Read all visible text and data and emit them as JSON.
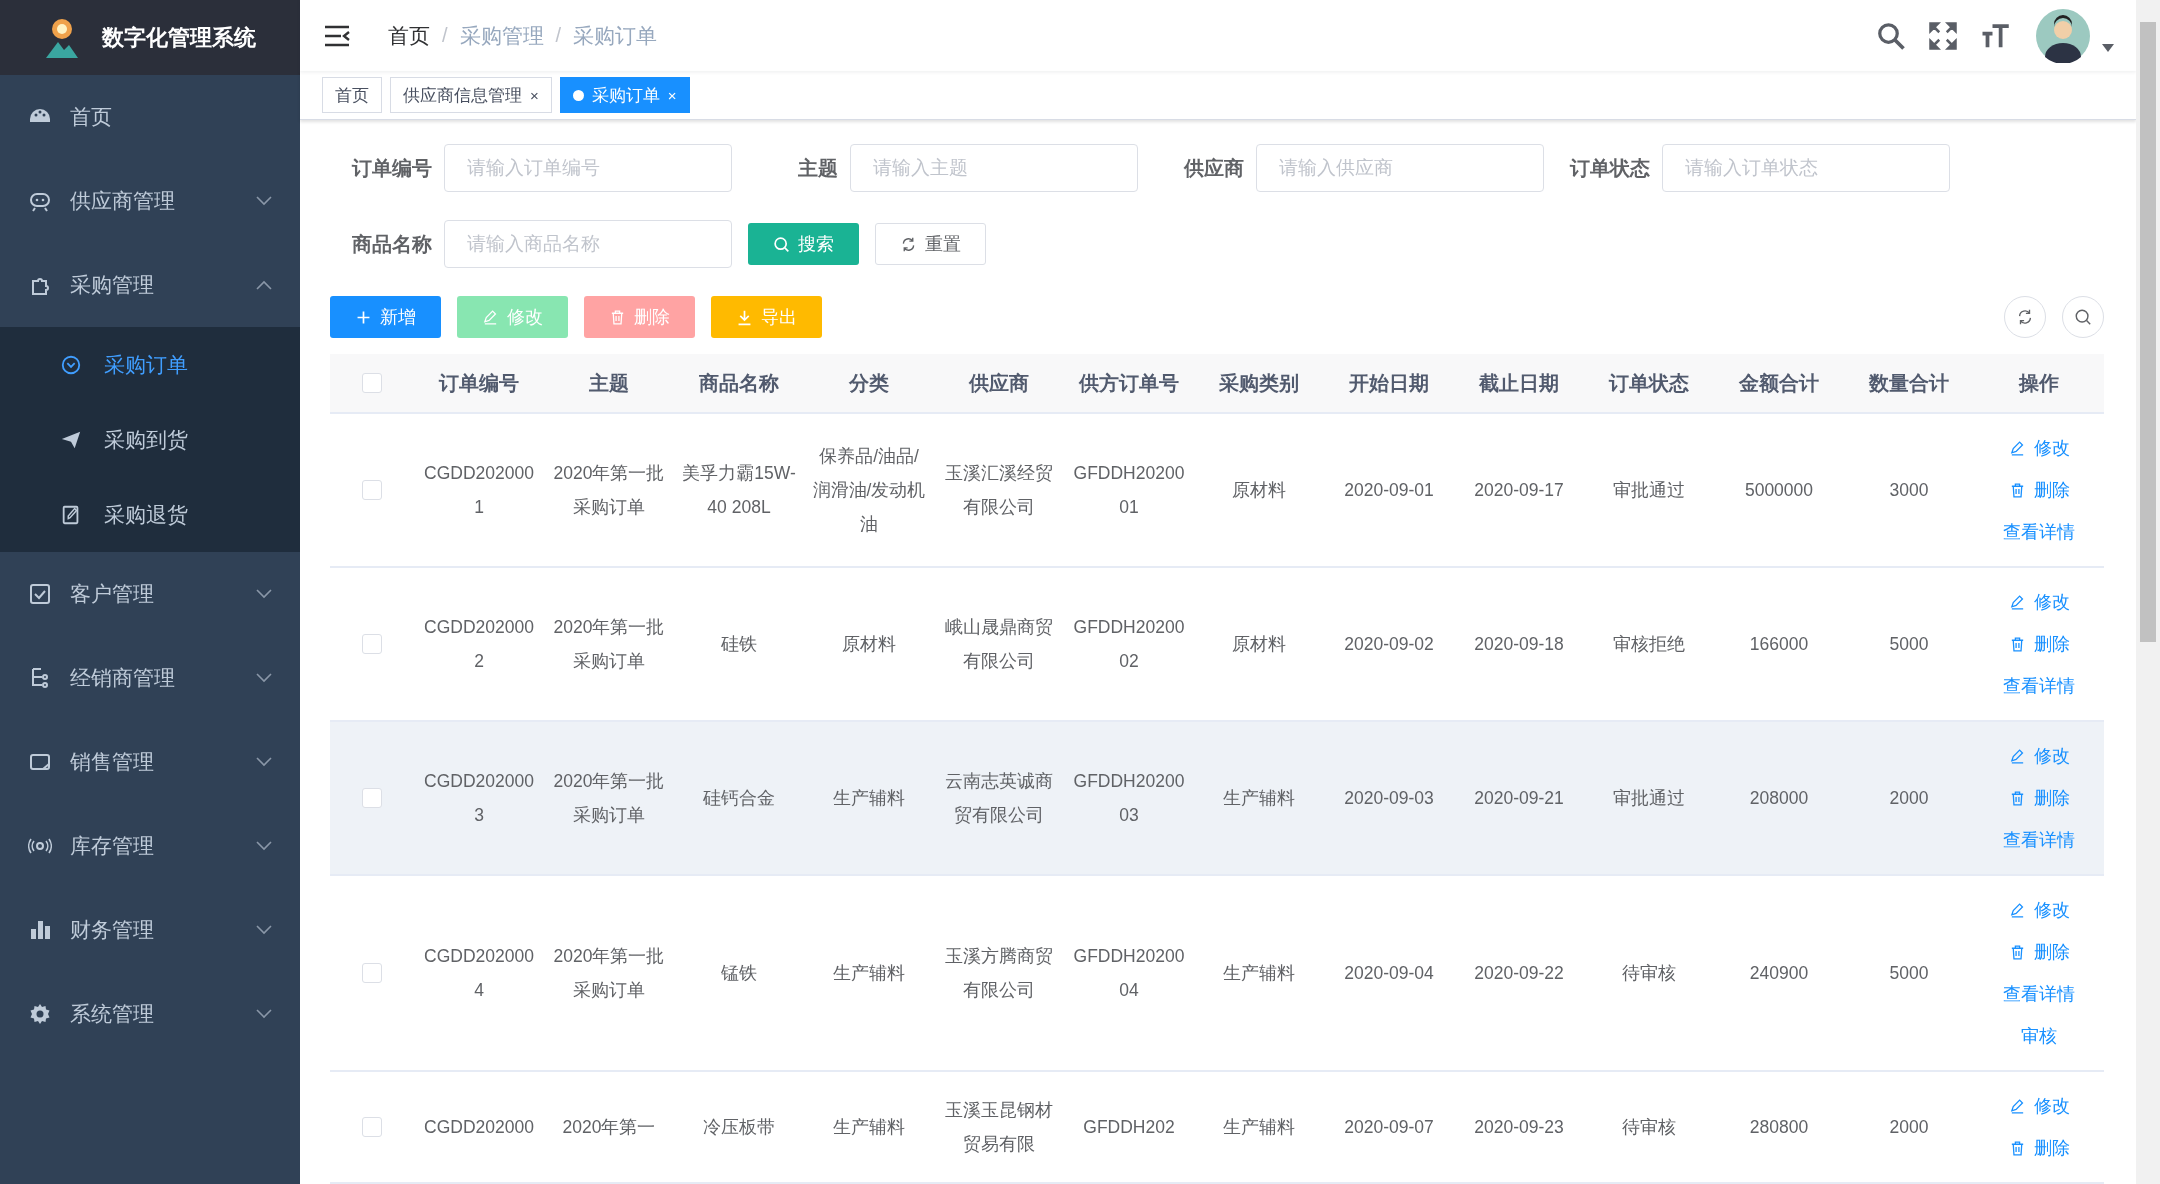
{
  "sidebar": {
    "title": "数字化管理系统",
    "items": [
      {
        "label": "首页",
        "has_children": false
      },
      {
        "label": "供应商管理",
        "expanded": false,
        "has_children": true
      },
      {
        "label": "采购管理",
        "expanded": true,
        "has_children": true,
        "children": [
          {
            "label": "采购订单",
            "selected": true
          },
          {
            "label": "采购到货",
            "selected": false
          },
          {
            "label": "采购退货",
            "selected": false
          }
        ]
      },
      {
        "label": "客户管理",
        "expanded": false,
        "has_children": true
      },
      {
        "label": "经销商管理",
        "expanded": false,
        "has_children": true
      },
      {
        "label": "销售管理",
        "expanded": false,
        "has_children": true
      },
      {
        "label": "库存管理",
        "expanded": false,
        "has_children": true
      },
      {
        "label": "财务管理",
        "expanded": false,
        "has_children": true
      },
      {
        "label": "系统管理",
        "expanded": false,
        "has_children": true
      }
    ]
  },
  "breadcrumb": [
    {
      "label": "首页"
    },
    {
      "separator": "/",
      "label": "采购管理"
    },
    {
      "separator": "/",
      "label": "采购订单"
    }
  ],
  "tabs": [
    {
      "label": "首页",
      "selected": false,
      "closable": false
    },
    {
      "label": "供应商信息管理",
      "selected": false,
      "closable": true,
      "close": "×"
    },
    {
      "label": "采购订单",
      "selected": true,
      "closable": true,
      "close": "×"
    }
  ],
  "filters": [
    {
      "label": "订单编号",
      "placeholder": "请输入订单编号"
    },
    {
      "label": "主题",
      "placeholder": "请输入主题"
    },
    {
      "label": "供应商",
      "placeholder": "请输入供应商"
    },
    {
      "label": "订单状态",
      "placeholder": "请输入订单状态"
    },
    {
      "label": "商品名称",
      "placeholder": "请输入商品名称"
    }
  ],
  "search_button": "搜索",
  "reset_button": "重置",
  "toolbar": [
    {
      "kind": "add",
      "label": "新增",
      "disabled": false
    },
    {
      "kind": "edit",
      "label": "修改",
      "disabled": true
    },
    {
      "kind": "delete",
      "label": "删除",
      "disabled": true
    },
    {
      "kind": "export",
      "label": "导出",
      "disabled": false
    }
  ],
  "table": {
    "all_checked": false,
    "columns": [
      "订单编号",
      "主题",
      "商品名称",
      "分类",
      "供应商",
      "供方订单号",
      "采购类别",
      "开始日期",
      "截止日期",
      "订单状态",
      "金额合计",
      "数量合计",
      "操作"
    ],
    "rows": [
      {
        "checked": false,
        "hovered": false,
        "cells": [
          "CGDD2020001",
          "2020年第一批采购订单",
          "美孚力霸15W-40 208L",
          "保养品/油品/润滑油/发动机油",
          "玉溪汇溪经贸有限公司",
          "GFDDH2020001",
          "原材料",
          "2020-09-01",
          "2020-09-17",
          "审批通过",
          "5000000",
          "3000"
        ],
        "actions": [
          {
            "kind": "edit",
            "label": "修改"
          },
          {
            "kind": "delete",
            "label": "删除"
          },
          {
            "kind": "detail",
            "label": "查看详情"
          }
        ]
      },
      {
        "checked": false,
        "hovered": false,
        "cells": [
          "CGDD2020002",
          "2020年第一批采购订单",
          "硅铁",
          "原材料",
          "峨山晟鼎商贸有限公司",
          "GFDDH2020002",
          "原材料",
          "2020-09-02",
          "2020-09-18",
          "审核拒绝",
          "166000",
          "5000"
        ],
        "actions": [
          {
            "kind": "edit",
            "label": "修改"
          },
          {
            "kind": "delete",
            "label": "删除"
          },
          {
            "kind": "detail",
            "label": "查看详情"
          }
        ]
      },
      {
        "checked": false,
        "hovered": true,
        "cells": [
          "CGDD2020003",
          "2020年第一批采购订单",
          "硅钙合金",
          "生产辅料",
          "云南志英诚商贸有限公司",
          "GFDDH2020003",
          "生产辅料",
          "2020-09-03",
          "2020-09-21",
          "审批通过",
          "208000",
          "2000"
        ],
        "actions": [
          {
            "kind": "edit",
            "label": "修改"
          },
          {
            "kind": "delete",
            "label": "删除"
          },
          {
            "kind": "detail",
            "label": "查看详情"
          }
        ]
      },
      {
        "checked": false,
        "hovered": false,
        "cells": [
          "CGDD2020004",
          "2020年第一批采购订单",
          "锰铁",
          "生产辅料",
          "玉溪方腾商贸有限公司",
          "GFDDH2020004",
          "生产辅料",
          "2020-09-04",
          "2020-09-22",
          "待审核",
          "240900",
          "5000"
        ],
        "actions": [
          {
            "kind": "edit",
            "label": "修改"
          },
          {
            "kind": "delete",
            "label": "删除"
          },
          {
            "kind": "detail",
            "label": "查看详情"
          },
          {
            "kind": "audit",
            "label": "审核"
          }
        ]
      },
      {
        "checked": false,
        "hovered": false,
        "cells": [
          "CGDD202000",
          "2020年第一",
          "冷压板带",
          "生产辅料",
          "玉溪玉昆钢材贸易有限",
          "GFDDH202",
          "生产辅料",
          "2020-09-07",
          "2020-09-23",
          "待审核",
          "280800",
          "2000"
        ],
        "actions": [
          {
            "kind": "edit",
            "label": "修改"
          },
          {
            "kind": "delete",
            "label": "删除"
          }
        ]
      }
    ]
  }
}
